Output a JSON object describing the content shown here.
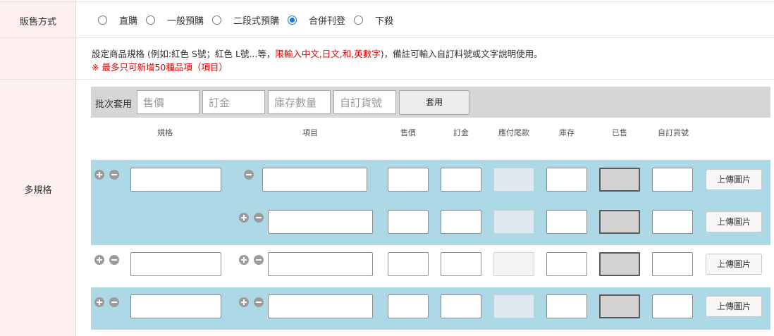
{
  "sales_method": {
    "label": "販售方式",
    "options": [
      "直購",
      "一般預購",
      "二段式預購",
      "合併刊登",
      "下殺"
    ],
    "selected": "合併刊登"
  },
  "spec_note": {
    "line1_a": "設定商品規格 (例如:紅色 S號；紅色 L號...等，",
    "line1_red": "限輸入中文,日文,和,英數字",
    "line1_b": ")，備註可輸入自訂料號或文字說明使用。",
    "line2": "※ 最多只可新增50種品項（項目）"
  },
  "multi_spec": {
    "label": "多規格",
    "batch": {
      "label": "批次套用",
      "price_placeholder": "售價",
      "deposit_placeholder": "訂金",
      "stock_placeholder": "庫存數量",
      "sku_placeholder": "自訂貨號",
      "apply_label": "套用"
    },
    "columns": {
      "spec": "規格",
      "item": "項目",
      "price": "售價",
      "deposit": "訂金",
      "due": "應付尾款",
      "stock": "庫存",
      "sold": "已售",
      "sku": "自訂貨號"
    },
    "upload_label": "上傳圖片"
  },
  "colors": {
    "label_bg": "#fdeef0",
    "band_blue": "#add8e6",
    "batch_bar": "#d6d6d6",
    "accent_red": "#e00000",
    "radio_checked": "#1a73e8"
  },
  "icons": [
    "plus-circle-icon",
    "minus-circle-icon"
  ]
}
